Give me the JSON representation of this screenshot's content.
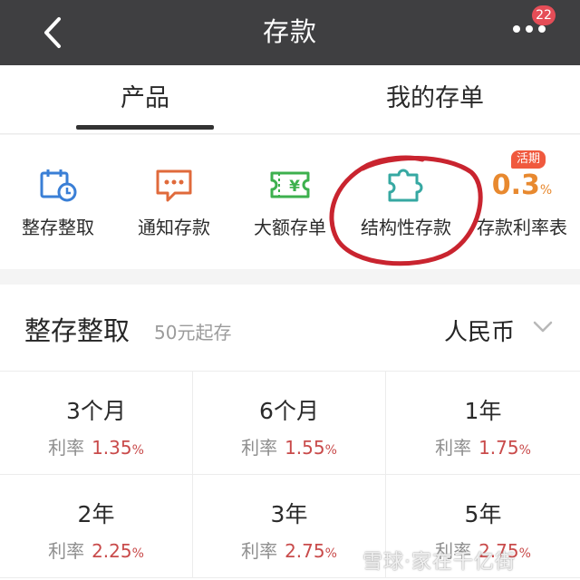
{
  "header": {
    "title": "存款",
    "badge_count": "22"
  },
  "tabs": [
    {
      "label": "产品",
      "active": true
    },
    {
      "label": "我的存单",
      "active": false
    }
  ],
  "menu": [
    {
      "label": "整存整取",
      "icon": "calendar-clock-icon",
      "color": "#3a7fd6"
    },
    {
      "label": "通知存款",
      "icon": "chat-bubble-icon",
      "color": "#e06a3b"
    },
    {
      "label": "大额存单",
      "icon": "yen-ticket-icon",
      "color": "#3db04e"
    },
    {
      "label": "结构性存款",
      "icon": "puzzle-icon",
      "color": "#36a8a2"
    },
    {
      "label": "存款利率表",
      "icon": "rate-icon",
      "rate_value": "0.3",
      "rate_unit": "%",
      "tag": "活期"
    }
  ],
  "section": {
    "title": "整存整取",
    "subtitle": "50元起存",
    "currency": "人民币",
    "rate_label": "利率",
    "products": [
      {
        "term": "3个月",
        "rate": "1.35",
        "unit": "%"
      },
      {
        "term": "6个月",
        "rate": "1.55",
        "unit": "%"
      },
      {
        "term": "1年",
        "rate": "1.75",
        "unit": "%"
      },
      {
        "term": "2年",
        "rate": "2.25",
        "unit": "%"
      },
      {
        "term": "3年",
        "rate": "2.75",
        "unit": "%"
      },
      {
        "term": "5年",
        "rate": "2.75",
        "unit": "%"
      }
    ]
  },
  "watermark": "雪球·家在千亿街",
  "colors": {
    "header_bg": "#3f3f41",
    "rate_red": "#c94b4b",
    "annotation_circle": "#c9242f"
  }
}
